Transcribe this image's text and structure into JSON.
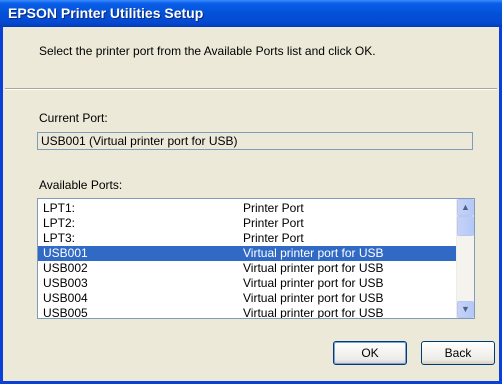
{
  "window": {
    "title": "EPSON Printer Utilities Setup"
  },
  "instruction": "Select the printer port from the Available Ports list and click OK.",
  "current_port": {
    "label": "Current Port:",
    "value": "USB001 (Virtual printer port for USB)"
  },
  "available_ports": {
    "label": "Available Ports:",
    "selected_index": 3,
    "rows": [
      {
        "port": "LPT1:",
        "description": "Printer Port"
      },
      {
        "port": "LPT2:",
        "description": "Printer Port"
      },
      {
        "port": "LPT3:",
        "description": "Printer Port"
      },
      {
        "port": "USB001",
        "description": "Virtual printer port for USB"
      },
      {
        "port": "USB002",
        "description": "Virtual printer port for USB"
      },
      {
        "port": "USB003",
        "description": "Virtual printer port for USB"
      },
      {
        "port": "USB004",
        "description": "Virtual printer port for USB"
      },
      {
        "port": "USB005",
        "description": "Virtual printer port for USB"
      }
    ]
  },
  "buttons": {
    "ok": "OK",
    "back": "Back"
  },
  "icons": {
    "scroll_up": "scroll-up-arrow-icon",
    "scroll_down": "scroll-down-arrow-icon"
  },
  "colors": {
    "titlebar": "#0a5fe8",
    "selection": "#316ac5",
    "dialog_bg": "#ece9d8"
  }
}
